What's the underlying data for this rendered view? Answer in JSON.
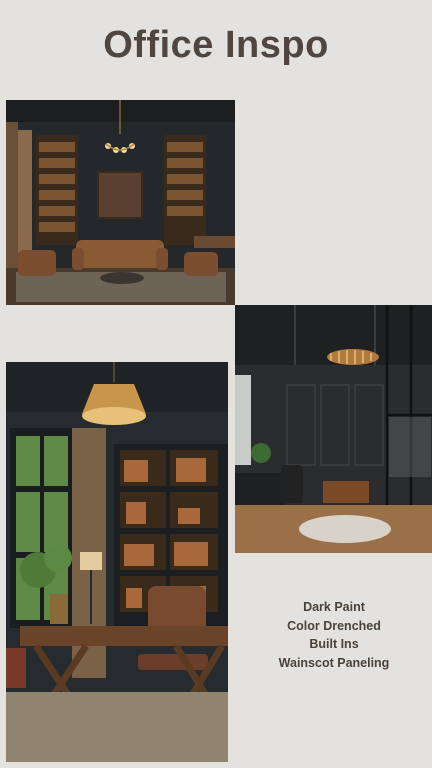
{
  "header": {
    "title": "Office Inspo"
  },
  "photos": [
    {
      "subject": "dark-library-office-with-chandelier-and-leather-sofa"
    },
    {
      "subject": "dark-paneled-office-with-round-chandelier-and-glass-partition"
    },
    {
      "subject": "dark-office-with-crystal-chandelier-built-in-shelves-and-wood-desk"
    }
  ],
  "features": [
    "Dark Paint",
    "Color Drenched",
    "Built Ins",
    "Wainscot Paneling"
  ],
  "colors": {
    "background": "#e4e2df",
    "text": "#4e463f",
    "wall": "#2a2d30",
    "leather": "#8a5a35"
  }
}
